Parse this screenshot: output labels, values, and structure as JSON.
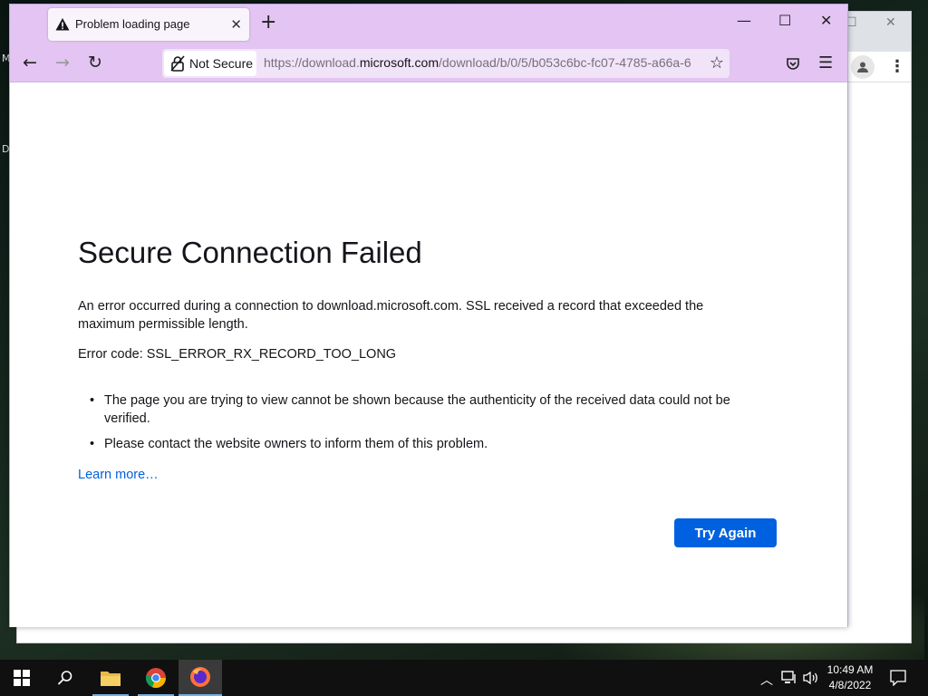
{
  "desktop": {
    "edge_letters": [
      "M",
      "D"
    ]
  },
  "tab": {
    "title": "Problem loading page"
  },
  "urlbar": {
    "security_label": "Not Secure",
    "url_prefix": "https://download.",
    "url_host": "microsoft.com",
    "url_path": "/download/b/0/5/b053c6bc-fc07-4785-a66a-6"
  },
  "error": {
    "title": "Secure Connection Failed",
    "description": "An error occurred during a connection to download.microsoft.com. SSL received a record that exceeded the maximum permissible length.",
    "code": "Error code: SSL_ERROR_RX_RECORD_TOO_LONG",
    "bullets": [
      "The page you are trying to view cannot be shown because the authenticity of the received data could not be verified.",
      "Please contact the website owners to inform them of this problem."
    ],
    "learn_more": "Learn more…",
    "try_again": "Try Again"
  },
  "clock": {
    "time": "10:49 AM",
    "date": "4/8/2022"
  },
  "colors": {
    "toolbar": "#e3c4f2",
    "accent_button": "#0061e0",
    "link": "#0061e0"
  }
}
